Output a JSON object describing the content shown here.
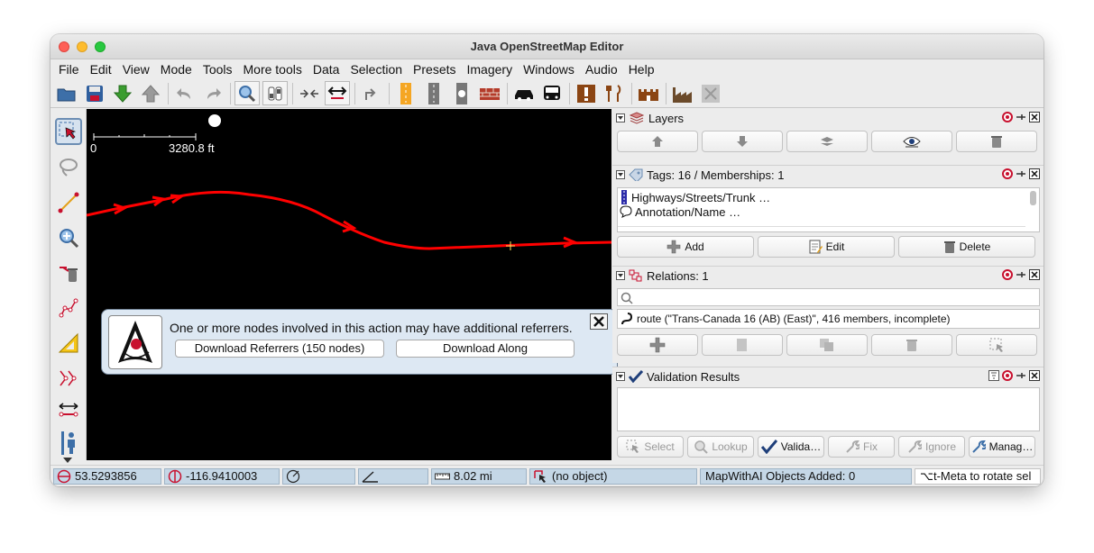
{
  "window": {
    "title": "Java OpenStreetMap Editor"
  },
  "menu": [
    "File",
    "Edit",
    "View",
    "Mode",
    "Tools",
    "More tools",
    "Data",
    "Selection",
    "Presets",
    "Imagery",
    "Windows",
    "Audio",
    "Help"
  ],
  "map": {
    "scale_start": "0",
    "scale_end": "3280.8 ft"
  },
  "layers": {
    "title": "Layers"
  },
  "tags": {
    "title": "Tags: 16 / Memberships: 1",
    "items": [
      "Highways/Streets/Trunk …",
      "Annotation/Name …"
    ],
    "add": "Add",
    "edit": "Edit",
    "delete": "Delete"
  },
  "relations": {
    "title": "Relations: 1",
    "item": "route (\"Trans-Canada 16 (AB) (East)\", 416 members, incomplete)"
  },
  "validation": {
    "title": "Validation Results",
    "select": "Select",
    "lookup": "Lookup",
    "validate": "Valida…",
    "fix": "Fix",
    "ignore": "Ignore",
    "manage": "Manag…"
  },
  "notification": {
    "message": "One or more nodes involved in this action may have additional referrers.",
    "download_referrers": "Download Referrers (150 nodes)",
    "download_along": "Download Along"
  },
  "status": {
    "lat": "53.5293856",
    "lon": "-116.9410003",
    "distance": "8.02 mi",
    "object": "(no object)",
    "mapwithai": "MapWithAI Objects Added: 0",
    "hint": "⌥t-Meta to rotate sel"
  },
  "colors": {
    "way": "#ff0000",
    "status_field": "#c5d7e6",
    "notification": "#dde8f3"
  }
}
